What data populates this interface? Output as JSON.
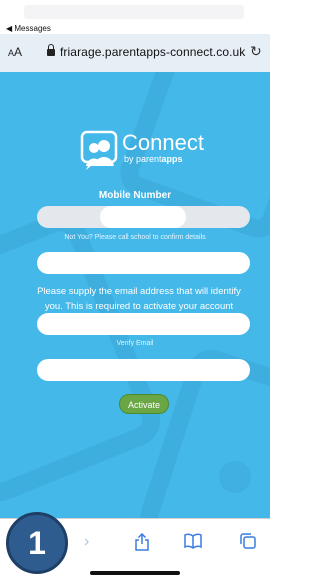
{
  "status_bar": {
    "back_label": "◀ Messages"
  },
  "browser": {
    "text_size_label_small": "A",
    "text_size_label_large": "A",
    "url": "friarage.parentapps-connect.co.uk",
    "reload_icon": "reload-icon"
  },
  "logo": {
    "title": "Connect",
    "sub_prefix": "by parent",
    "sub_bold": "apps"
  },
  "form": {
    "mobile_label": "Mobile Number",
    "mobile_value": "",
    "not_you_note": "Not You? Please call school to confirm details",
    "email_value": "",
    "info_text": "Please supply the email address that will identify you. This is required to activate your account",
    "verify_email_value": "",
    "verify_label": "Verify Email",
    "final_value": "",
    "activate_label": "Activate"
  },
  "toolbar": {
    "icons": [
      "back-icon",
      "forward-icon",
      "share-icon",
      "bookmarks-icon",
      "tabs-icon"
    ]
  },
  "step_badge": "1",
  "colors": {
    "background": "#44b8e9",
    "activate": "#6aa744",
    "badge": "#2e5c8f"
  }
}
